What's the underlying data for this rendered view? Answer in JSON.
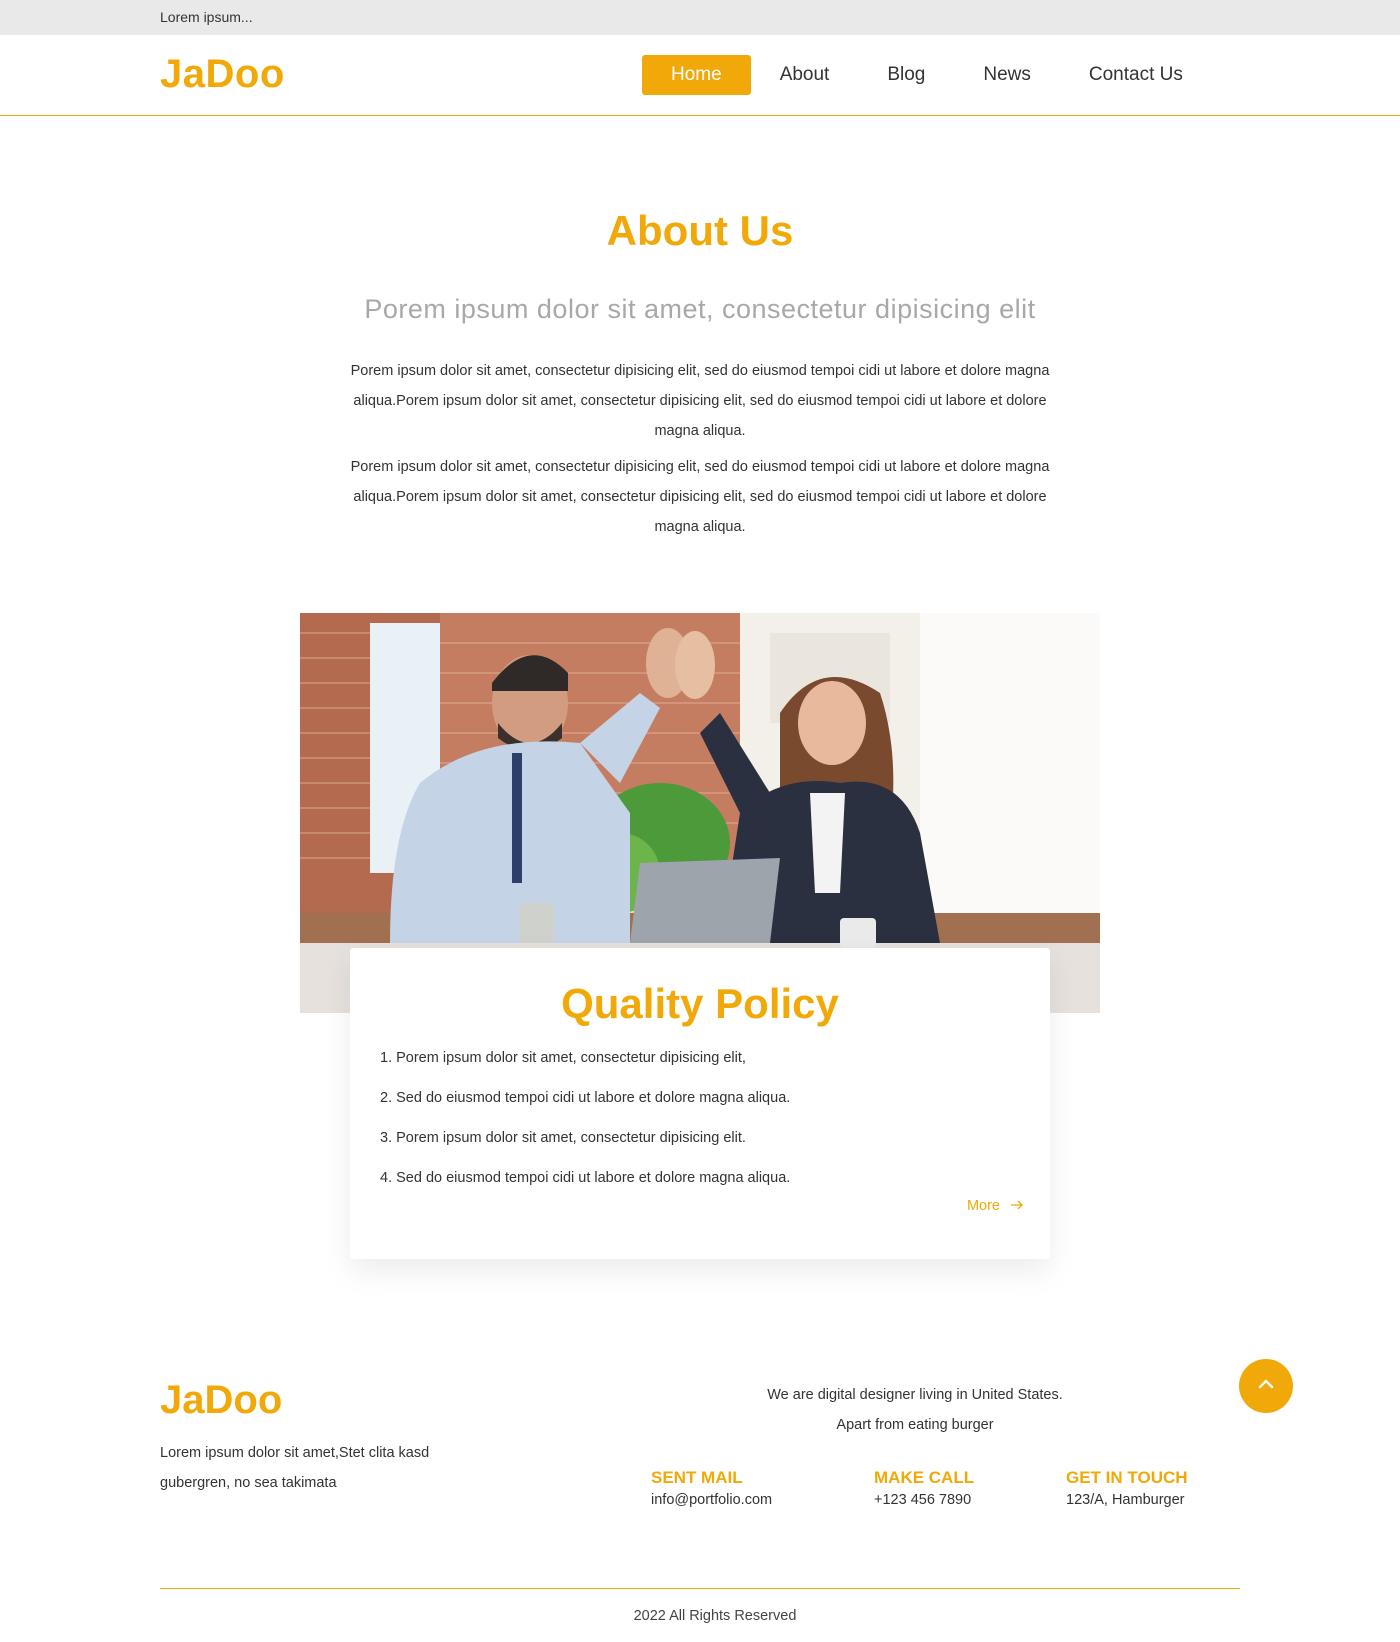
{
  "topbar": {
    "text": "Lorem ipsum..."
  },
  "header": {
    "logo": "JaDoo",
    "nav": [
      "Home",
      "About",
      "Blog",
      "News",
      "Contact Us"
    ],
    "active_index": 0
  },
  "about": {
    "title": "About Us",
    "subtitle": "Porem ipsum dolor sit amet, consectetur dipisicing elit",
    "paragraphs": [
      "Porem ipsum dolor sit amet, consectetur dipisicing elit, sed do eiusmod tempoi cidi ut labore et dolore magna aliqua.Porem ipsum dolor sit amet, consectetur dipisicing elit, sed do eiusmod tempoi cidi ut labore et dolore magna aliqua.",
      "Porem ipsum dolor sit amet, consectetur dipisicing elit, sed do eiusmod tempoi cidi ut labore et dolore magna aliqua.Porem ipsum dolor sit amet, consectetur dipisicing elit, sed do eiusmod tempoi cidi ut labore et dolore magna aliqua."
    ]
  },
  "photo": {
    "icon": "office-high-five-photo"
  },
  "quality": {
    "title": "Quality Policy",
    "items": [
      "1. Porem ipsum dolor sit amet, consectetur dipisicing elit,",
      "2. Sed do eiusmod tempoi cidi ut labore et dolore magna aliqua.",
      "3. Porem ipsum dolor sit amet, consectetur dipisicing elit.",
      "4. Sed do eiusmod tempoi cidi ut labore et dolore magna aliqua."
    ],
    "more_label": "More",
    "more_icon": "arrow-right-icon"
  },
  "footer": {
    "logo": "JaDoo",
    "description": "Lorem ipsum dolor sit amet,Stet clita kasd gubergren, no sea takimata",
    "tagline_1": "We are digital designer living in United States.",
    "tagline_2": "Apart from eating burger",
    "contacts": [
      {
        "heading": "SENT MAIL",
        "value": "info@portfolio.com"
      },
      {
        "heading": "MAKE CALL",
        "value": "+123 456 7890"
      },
      {
        "heading": "GET IN TOUCH",
        "value": "123/A, Hamburger"
      }
    ],
    "to_top_icon": "chevron-up-icon",
    "copyright": "2022 All Rights Reserved"
  },
  "colors": {
    "accent": "#f0a909",
    "topbar": "#e9e9e9",
    "text": "#333333",
    "subtitle": "#a8a8a8"
  }
}
